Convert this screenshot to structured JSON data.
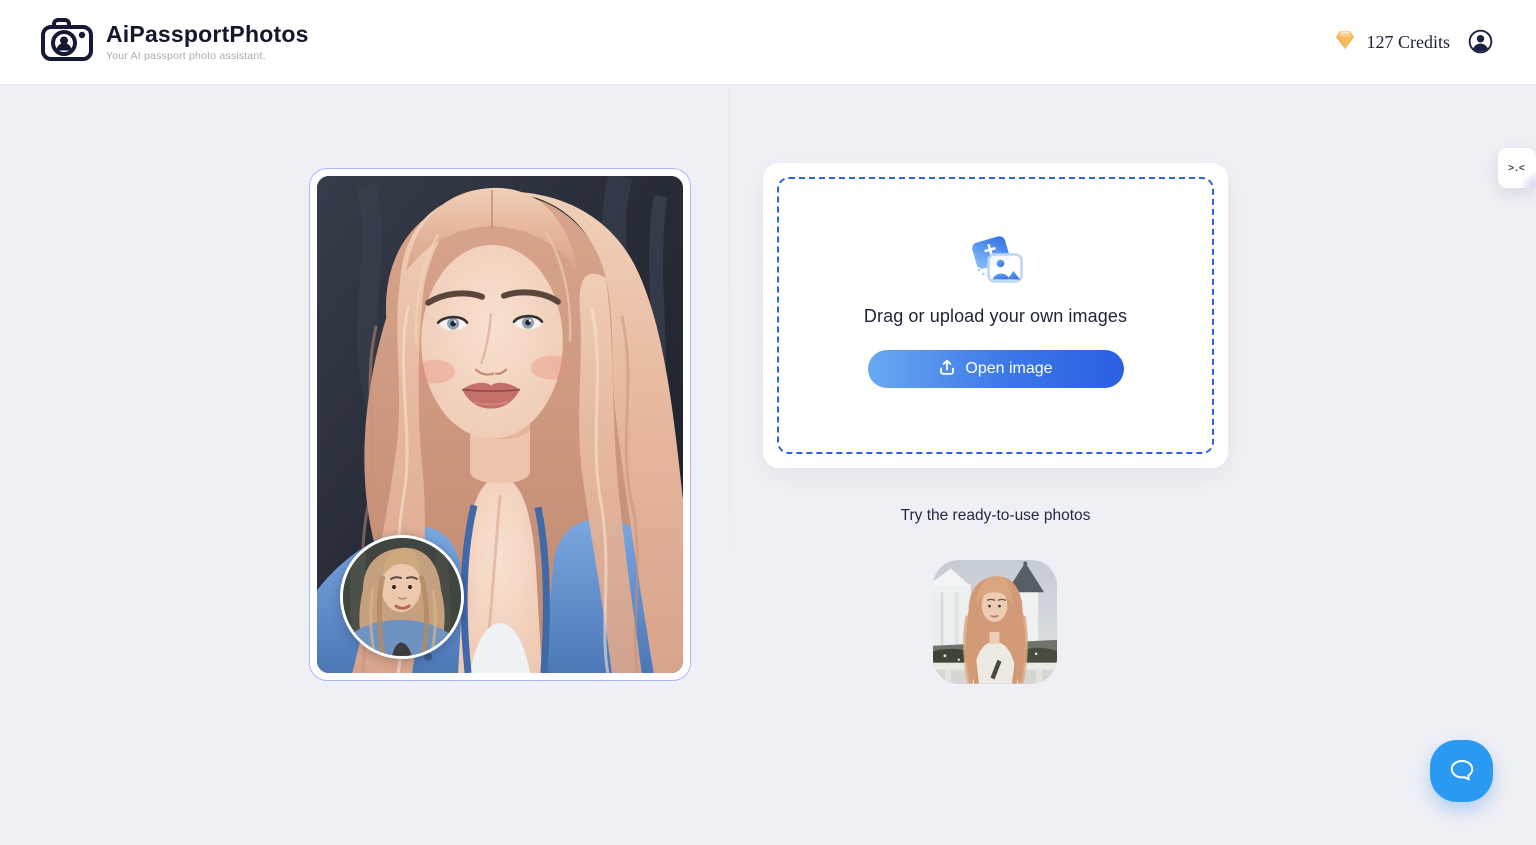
{
  "app": {
    "title": "AiPassportPhotos",
    "tagline": "Your AI passport photo assistant."
  },
  "header": {
    "credits_label": "127 Credits",
    "icons": {
      "logo": "camera-logo-icon",
      "credits": "gem-icon",
      "account": "account-icon"
    }
  },
  "uploader": {
    "heading": "Drag or upload your own images",
    "open_button": "Open image",
    "icons": {
      "cluster": "upload-images-icon",
      "button": "upload-arrow-icon"
    }
  },
  "samples": {
    "heading": "Try the ready-to-use photos"
  },
  "preview": {
    "main_label": "generated-portrait-preview",
    "inset_label": "original-photo-inset"
  },
  "side_tab": {
    "glyph": ">.<"
  },
  "chat": {
    "icon": "chat-bubble-icon"
  },
  "colors": {
    "accent_blue": "#2a63e8",
    "button_gradient_start": "#67aaf1",
    "button_gradient_end": "#2a5fe1",
    "chat_blue": "#2b9af3",
    "gem_amber": "#f4b04a",
    "page_bg": "#eff0f5",
    "ink": "#12172e",
    "preview_border": "#aeb8f2"
  }
}
